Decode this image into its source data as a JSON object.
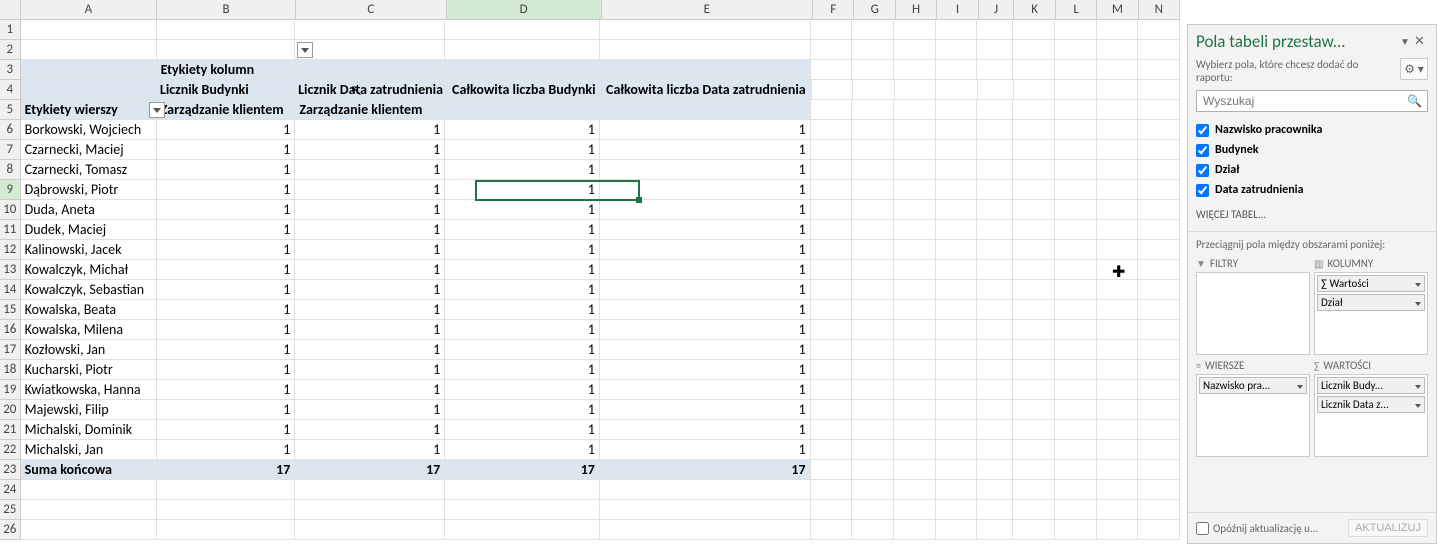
{
  "col_letters": [
    "A",
    "B",
    "C",
    "D",
    "E",
    "F",
    "G",
    "H",
    "I",
    "J",
    "K",
    "L",
    "M",
    "N"
  ],
  "pt": {
    "col_label": "Etykiety kolumn",
    "h1": "Licznik Budynki",
    "h2": "Licznik Data zatrudnienia",
    "h3": "Całkowita liczba Budynki",
    "h4": "Całkowita liczba Data zatrudnienia",
    "row_label": "Etykiety wierszy",
    "sub_b": "Zarządzanie klientem",
    "sub_c": "Zarządzanie klientem",
    "total": "Suma końcowa",
    "tv": "17"
  },
  "rows": [
    {
      "n": "Borkowski, Wojciech",
      "v": "1"
    },
    {
      "n": "Czarnecki, Maciej",
      "v": "1"
    },
    {
      "n": "Czarnecki, Tomasz",
      "v": "1"
    },
    {
      "n": "Dąbrowski, Piotr",
      "v": "1"
    },
    {
      "n": "Duda, Aneta",
      "v": "1"
    },
    {
      "n": "Dudek, Maciej",
      "v": "1"
    },
    {
      "n": "Kalinowski, Jacek",
      "v": "1"
    },
    {
      "n": "Kowalczyk, Michał",
      "v": "1"
    },
    {
      "n": "Kowalczyk, Sebastian",
      "v": "1"
    },
    {
      "n": "Kowalska, Beata",
      "v": "1"
    },
    {
      "n": "Kowalska, Milena",
      "v": "1"
    },
    {
      "n": "Kozłowski, Jan",
      "v": "1"
    },
    {
      "n": "Kucharski, Piotr",
      "v": "1"
    },
    {
      "n": "Kwiatkowska, Hanna",
      "v": "1"
    },
    {
      "n": "Majewski, Filip",
      "v": "1"
    },
    {
      "n": "Michalski, Dominik",
      "v": "1"
    },
    {
      "n": "Michalski, Jan",
      "v": "1"
    }
  ],
  "sidebar": {
    "title": "Pola tabeli przestaw...",
    "subtitle": "Wybierz pola, które chcesz dodać do raportu:",
    "search_ph": "Wyszukaj",
    "fields": [
      {
        "label": "Nazwisko pracownika",
        "checked": true,
        "bold": true
      },
      {
        "label": "Budynek",
        "checked": true,
        "bold": true
      },
      {
        "label": "Dział",
        "checked": true,
        "bold": true
      },
      {
        "label": "Data zatrudnienia",
        "checked": true,
        "bold": true
      }
    ],
    "more": "WIĘCEJ TABEL...",
    "drag_label": "Przeciągnij pola między obszarami poniżej:",
    "filters": "FILTRY",
    "columns": "KOLUMNY",
    "rows_h": "WIERSZE",
    "values": "WARTOŚCI",
    "col_chips": [
      "∑  Wartości",
      "Dział"
    ],
    "row_chips": [
      "Nazwisko pra..."
    ],
    "val_chips": [
      "Licznik Budy...",
      "Licznik Data z..."
    ],
    "defer": "Opóźnij aktualizację u...",
    "update": "AKTUALIZUJ"
  }
}
